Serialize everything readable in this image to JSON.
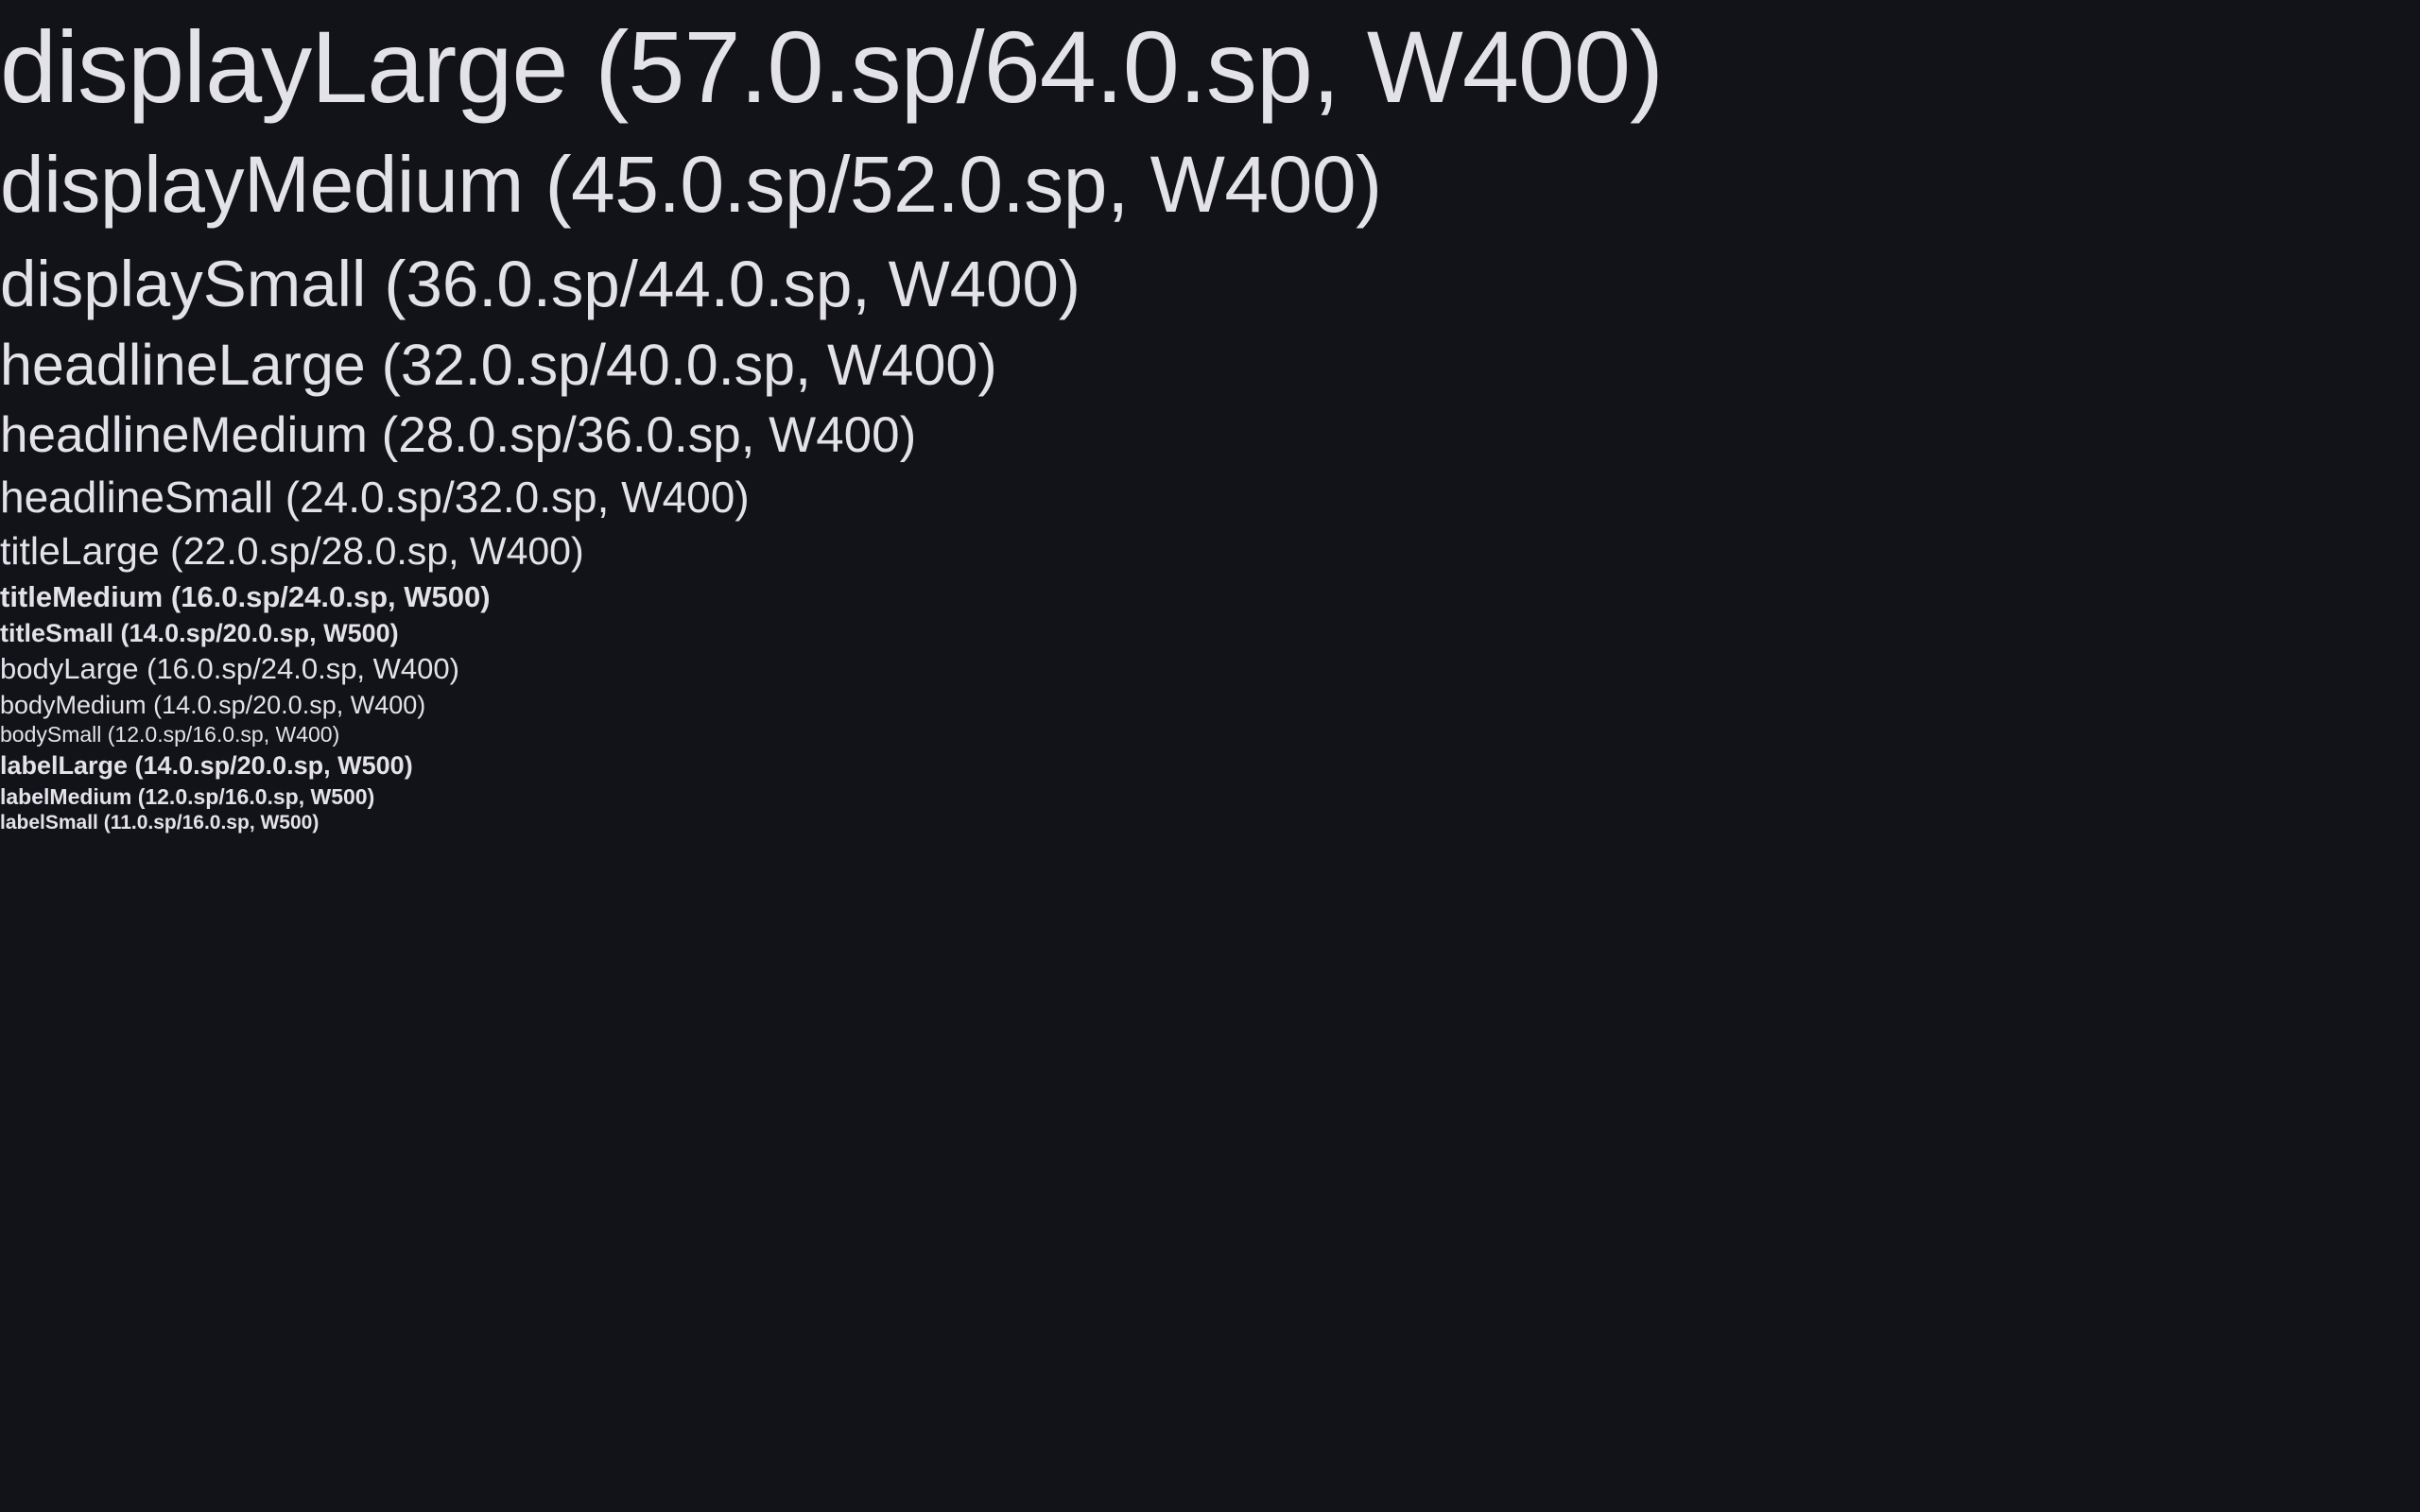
{
  "theme": {
    "background": "#121318",
    "text": "#e3e2e9"
  },
  "typography": {
    "displayLarge": "displayLarge (57.0.sp/64.0.sp, W400)",
    "displayMedium": "displayMedium (45.0.sp/52.0.sp, W400)",
    "displaySmall": "displaySmall (36.0.sp/44.0.sp, W400)",
    "headlineLarge": "headlineLarge (32.0.sp/40.0.sp, W400)",
    "headlineMedium": "headlineMedium (28.0.sp/36.0.sp, W400)",
    "headlineSmall": "headlineSmall (24.0.sp/32.0.sp, W400)",
    "titleLarge": "titleLarge (22.0.sp/28.0.sp, W400)",
    "titleMedium": "titleMedium (16.0.sp/24.0.sp, W500)",
    "titleSmall": "titleSmall (14.0.sp/20.0.sp, W500)",
    "bodyLarge": "bodyLarge (16.0.sp/24.0.sp, W400)",
    "bodyMedium": "bodyMedium (14.0.sp/20.0.sp, W400)",
    "bodySmall": "bodySmall (12.0.sp/16.0.sp, W400)",
    "labelLarge": "labelLarge (14.0.sp/20.0.sp, W500)",
    "labelMedium": "labelMedium (12.0.sp/16.0.sp, W500)",
    "labelSmall": "labelSmall (11.0.sp/16.0.sp, W500)"
  }
}
